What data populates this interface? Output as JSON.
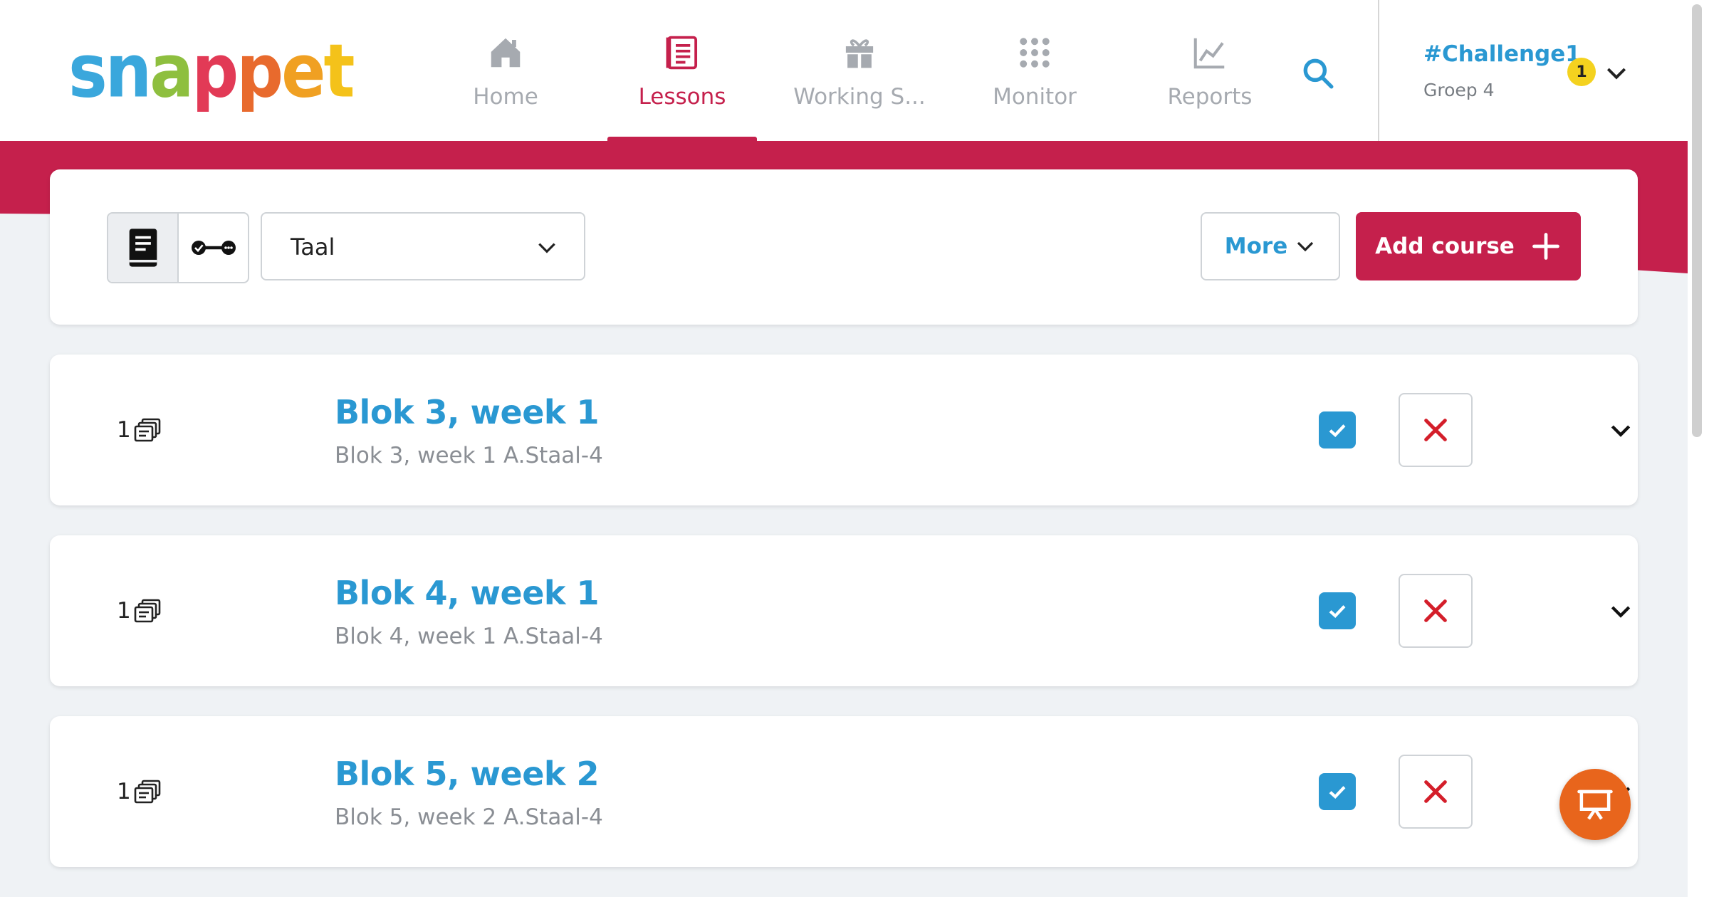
{
  "colors": {
    "brand": "#c5204c",
    "accent": "#2a98d2",
    "fab": "#e8651c",
    "badge": "#f4d21f"
  },
  "logo": {
    "letters": [
      {
        "ch": "s",
        "color": "#3aa7dc"
      },
      {
        "ch": "n",
        "color": "#3aa7dc"
      },
      {
        "ch": "a",
        "color": "#8ebf3f"
      },
      {
        "ch": "p",
        "color": "#e23a56"
      },
      {
        "ch": "p",
        "color": "#e86a2d"
      },
      {
        "ch": "e",
        "color": "#f0a022"
      },
      {
        "ch": "t",
        "color": "#f4c21a"
      }
    ]
  },
  "nav": {
    "items": [
      {
        "label": "Home",
        "icon": "home-icon"
      },
      {
        "label": "Lessons",
        "icon": "lessons-icon",
        "active": true
      },
      {
        "label": "Working S...",
        "icon": "gift-icon"
      },
      {
        "label": "Monitor",
        "icon": "grid-dots-icon"
      },
      {
        "label": "Reports",
        "icon": "chart-line-icon"
      }
    ],
    "search_icon": "search-icon"
  },
  "account": {
    "name": "#Challenge1",
    "group": "Groep 4",
    "badge": "1"
  },
  "toolbar": {
    "view_icons": [
      "book-icon",
      "timeline-icon"
    ],
    "subject": "Taal",
    "more_label": "More",
    "add_label": "Add course"
  },
  "lessons": [
    {
      "count": "1",
      "title": "Blok 3, week 1",
      "subtitle": "Blok 3, week 1 A.Staal-4",
      "checked": true
    },
    {
      "count": "1",
      "title": "Blok 4, week 1",
      "subtitle": "Blok 4, week 1 A.Staal-4",
      "checked": true
    },
    {
      "count": "1",
      "title": "Blok 5, week 2",
      "subtitle": "Blok 5, week 2 A.Staal-4",
      "checked": true
    }
  ],
  "fab_icon": "presentation-icon"
}
